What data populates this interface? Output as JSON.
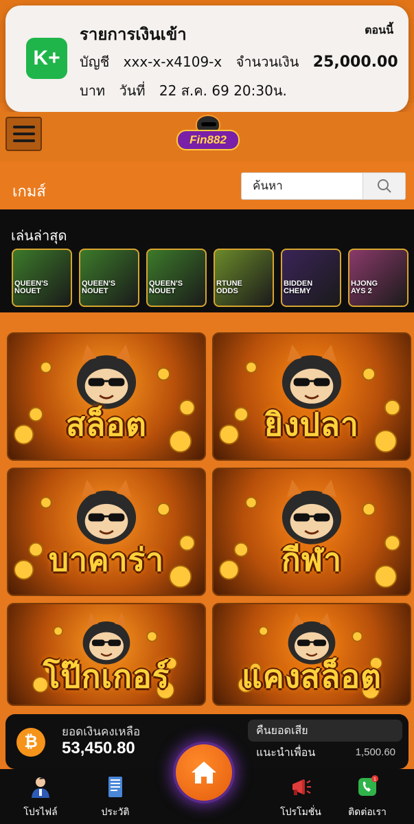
{
  "notification": {
    "title": "รายการเงินเข้า",
    "time": "ตอนนี้",
    "app_icon": "K+",
    "account_label": "บัญชี",
    "account_number": "xxx-x-x4109-x",
    "amount_label": "จำนวนเงิน",
    "amount_value": "25,000.00",
    "currency": "บาท",
    "date_label": "วันที่",
    "date_value": "22 ส.ค. 69 20:30น."
  },
  "header": {
    "logo_text": "Fin882",
    "menu_icon": "hamburger-icon"
  },
  "games": {
    "title": "เกมส์",
    "search_placeholder": "ค้นหา"
  },
  "recent": {
    "title": "เล่นล่าสุด",
    "items": [
      {
        "caption": "QUEEN'S\nNOUET",
        "bg": "#3c7a2a"
      },
      {
        "caption": "QUEEN'S\nNOUET",
        "bg": "#3c7a2a"
      },
      {
        "caption": "QUEEN'S\nNOUET",
        "bg": "#3c7a2a"
      },
      {
        "caption": "RTUNE\nODDS",
        "bg": "#6b8a2a"
      },
      {
        "caption": "BIDDEN\nCHEMY",
        "bg": "#3a2458"
      },
      {
        "caption": "HJONG\nAYS 2",
        "bg": "#8a3a6a"
      }
    ]
  },
  "categories": [
    {
      "label": "สล็อต",
      "accent": "#ff9a1f"
    },
    {
      "label": "ยิงปลา",
      "accent": "#ff8a14"
    },
    {
      "label": "บาคาร่า",
      "accent": "#ff9420"
    },
    {
      "label": "กีฬา",
      "accent": "#ff8818"
    },
    {
      "label": "โป๊กเกอร์",
      "accent": "#ff9a1f"
    },
    {
      "label": "แคงสล็อต",
      "accent": "#ff8a14"
    }
  ],
  "balance": {
    "coin_icon": "bitcoin-icon",
    "label": "ยอดเงินคงเหลือ",
    "value": "53,450.80",
    "rebate_label": "คืนยอดเสีย",
    "referral_label": "แนะนำเพื่อน",
    "referral_value": "1,500.60"
  },
  "nav": {
    "profile": "โปรไฟล์",
    "history": "ประวัติ",
    "home_icon": "home-icon",
    "promotion": "โปรโมชั่น",
    "contact": "ติดต่อเรา"
  }
}
